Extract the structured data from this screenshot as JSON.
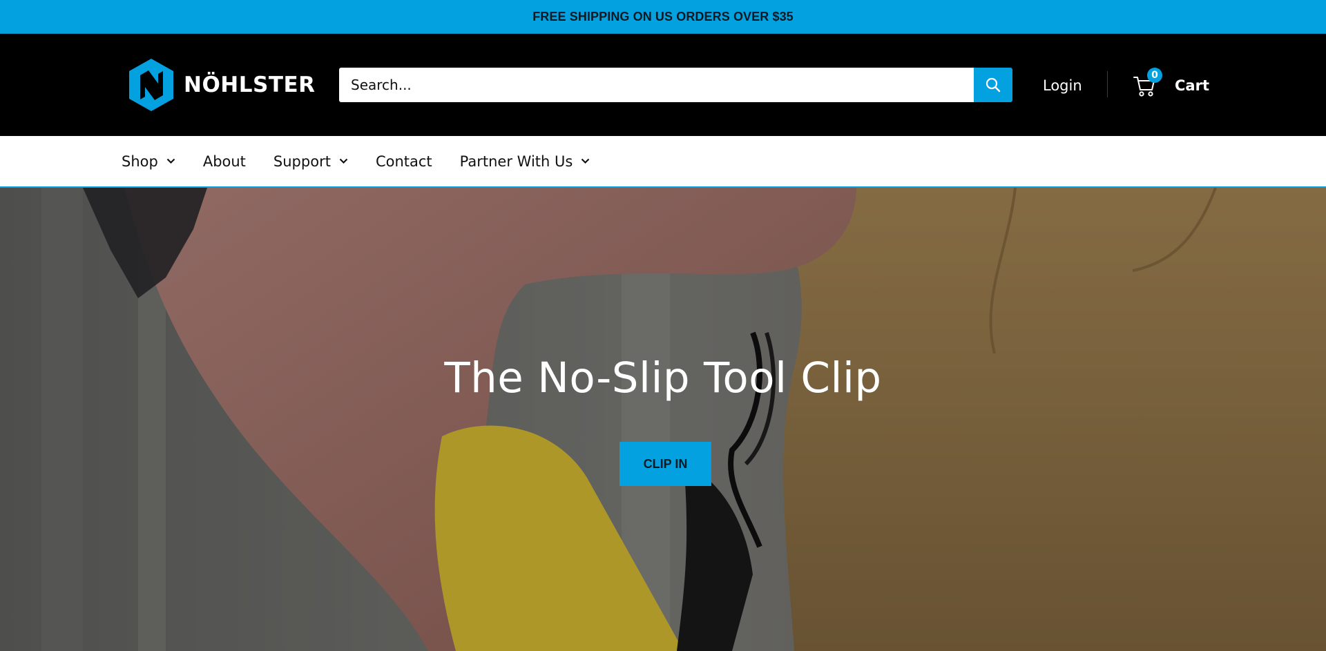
{
  "announcement": {
    "text": "FREE SHIPPING ON US ORDERS OVER $35"
  },
  "header": {
    "logo_text": "NÖHLSTER",
    "search": {
      "placeholder": "Search...",
      "value": ""
    },
    "login_label": "Login",
    "cart": {
      "count": "0",
      "label": "Cart"
    }
  },
  "nav": {
    "items": [
      {
        "label": "Shop",
        "has_dropdown": true
      },
      {
        "label": "About",
        "has_dropdown": false
      },
      {
        "label": "Support",
        "has_dropdown": true
      },
      {
        "label": "Contact",
        "has_dropdown": false
      },
      {
        "label": "Partner With Us",
        "has_dropdown": true
      }
    ]
  },
  "hero": {
    "title": "The No-Slip Tool Clip",
    "cta_label": "CLIP IN"
  },
  "colors": {
    "accent": "#04a1e0",
    "header_bg": "#000000",
    "nav_bg": "#ffffff"
  },
  "icons": [
    "logo-hexagon-icon",
    "search-icon",
    "cart-icon",
    "chevron-down-icon"
  ]
}
